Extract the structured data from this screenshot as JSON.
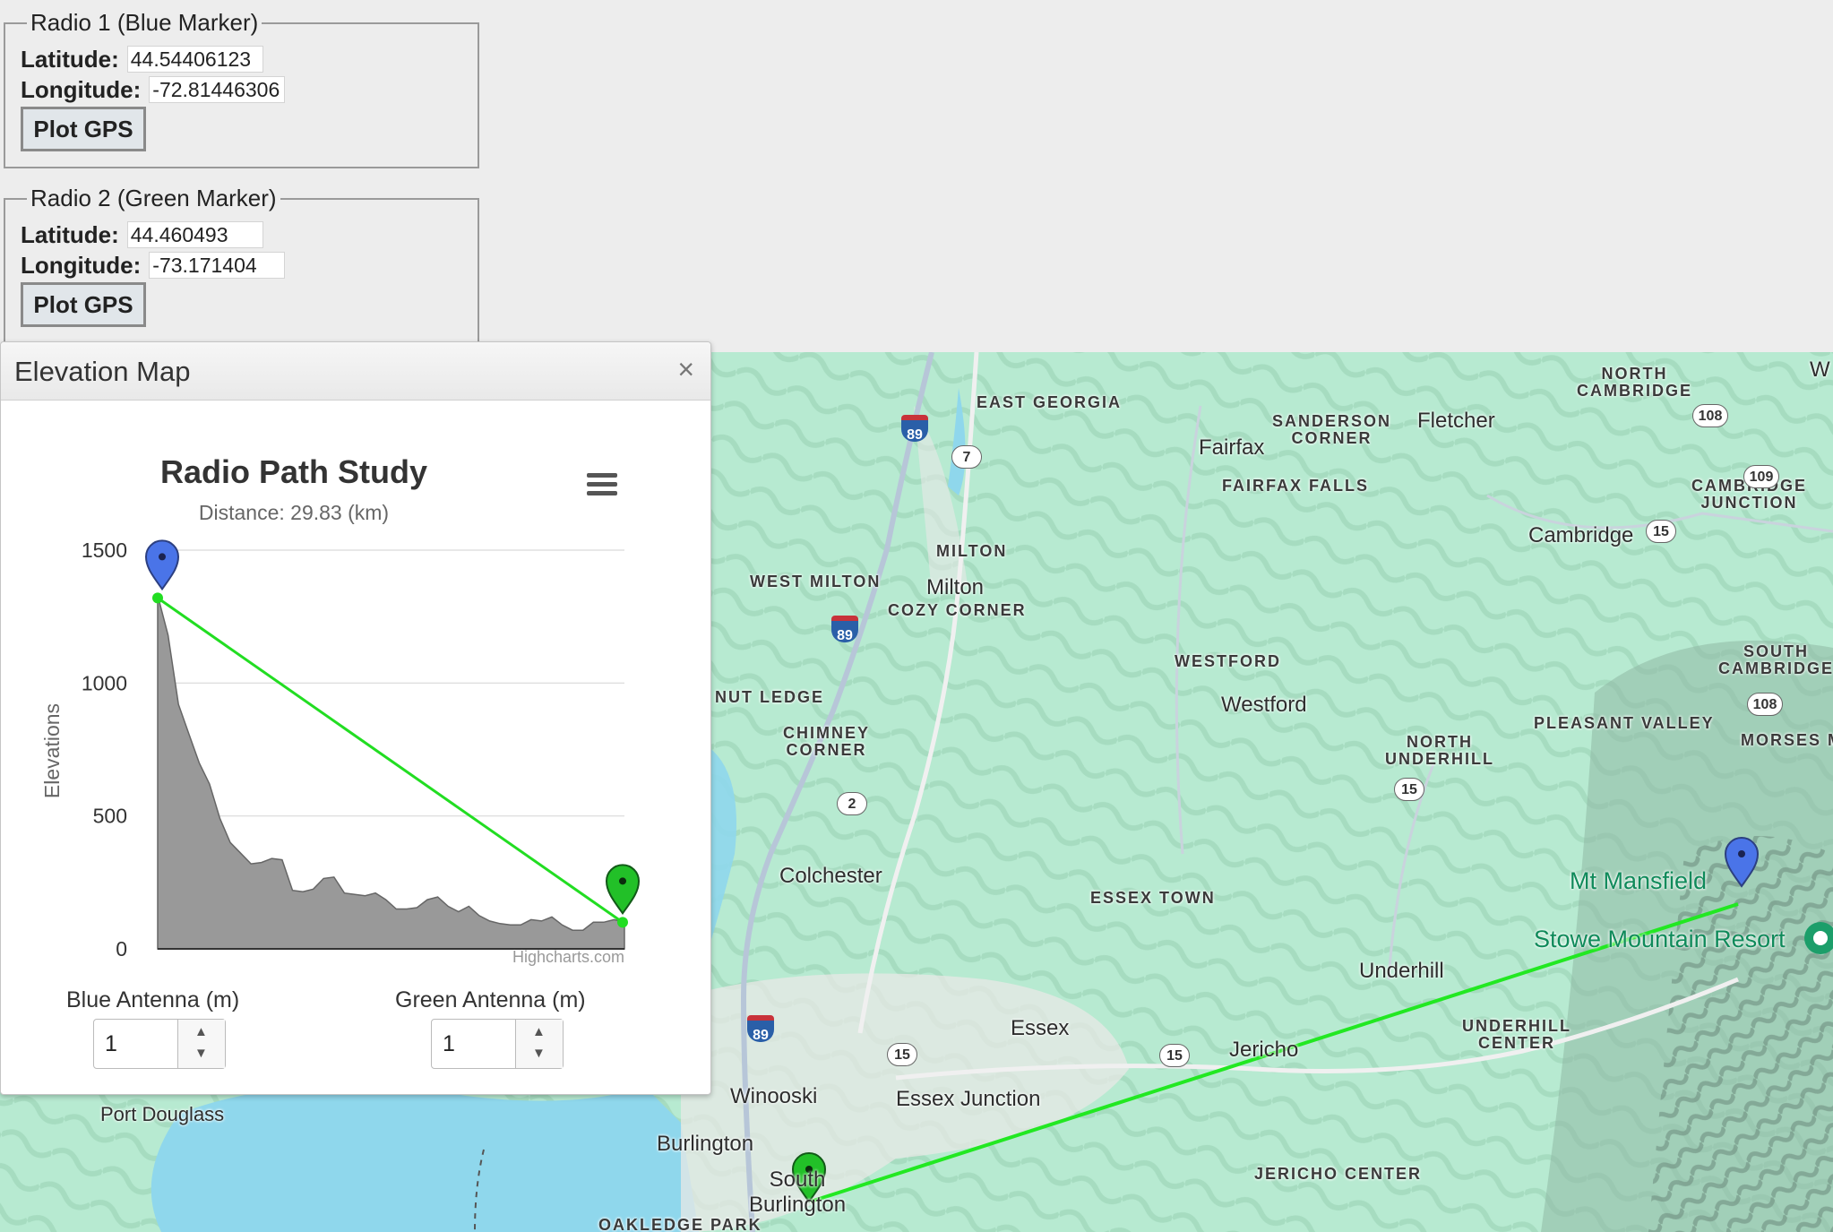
{
  "radio1": {
    "legend": "Radio 1 (Blue Marker)",
    "lat_label": "Latitude:",
    "lat_value": "44.54406123",
    "lon_label": "Longitude:",
    "lon_value": "-72.81446306",
    "button": "Plot GPS"
  },
  "radio2": {
    "legend": "Radio 2 (Green Marker)",
    "lat_label": "Latitude:",
    "lat_value": "44.460493",
    "lon_label": "Longitude:",
    "lon_value": "-73.171404",
    "button": "Plot GPS"
  },
  "dialog": {
    "title": "Elevation Map",
    "close": "×",
    "blue_antenna_label": "Blue Antenna (m)",
    "blue_antenna_value": "1",
    "green_antenna_label": "Green Antenna (m)",
    "green_antenna_value": "1",
    "up_arrow": "▲",
    "down_arrow": "▼"
  },
  "chart_data": {
    "type": "area",
    "title": "Radio Path Study",
    "subtitle": "Distance: 29.83 (km)",
    "ylabel": "Elevations",
    "xlabel": "",
    "ylim": [
      0,
      1500
    ],
    "yticks": [
      0,
      500,
      1000,
      1500
    ],
    "grid": true,
    "credit": "Highcharts.com",
    "series": [
      {
        "name": "",
        "color": "#999999",
        "values": [
          1330,
          1180,
          920,
          810,
          700,
          620,
          490,
          400,
          360,
          320,
          325,
          340,
          335,
          220,
          215,
          225,
          265,
          270,
          210,
          205,
          200,
          210,
          185,
          150,
          150,
          155,
          185,
          195,
          160,
          140,
          160,
          125,
          105,
          95,
          90,
          90,
          110,
          105,
          120,
          90,
          70,
          70,
          100,
          100,
          110,
          100
        ]
      }
    ],
    "path_line": {
      "color": "#22dd22",
      "start": 1320,
      "end": 100
    },
    "markers": [
      {
        "name": "blue-marker",
        "color": "#4a74e8",
        "position": "start"
      },
      {
        "name": "green-marker",
        "color": "#22c028",
        "position": "end"
      }
    ]
  },
  "map": {
    "labels": {
      "east_georgia": "EAST GEORGIA",
      "north_cambridge": "NORTH\nCAMBRIDGE",
      "w": "W",
      "sanderson_corner": "SANDERSON\nCORNER",
      "fletcher": "Fletcher",
      "fairfax": "Fairfax",
      "fairfax_falls": "FAIRFAX FALLS",
      "cambridge": "Cambridge",
      "cambridge_junction": "CAMBRIDGE\nJUNCTION",
      "milton_caps": "MILTON",
      "west_milton": "WEST MILTON",
      "milton": "Milton",
      "cozy_corner": "COZY CORNER",
      "westford_caps": "WESTFORD",
      "westford": "Westford",
      "south_cambridge": "SOUTH\nCAMBRIDGE",
      "nut_ledge": "NUT LEDGE",
      "chimney_corner": "CHIMNEY\nCORNER",
      "north_underhill": "NORTH\nUNDERHILL",
      "pleasant_valley": "PLEASANT VALLEY",
      "morses_m": "MORSES M",
      "colchester": "Colchester",
      "mt_mansfield": "Mt Mansfield",
      "stowe": "Stowe Mountain Resort",
      "essex_town": "ESSEX TOWN",
      "underhill": "Underhill",
      "essex": "Essex",
      "jericho": "Jericho",
      "underhill_center": "UNDERHILL\nCENTER",
      "winooski": "Winooski",
      "essex_junction": "Essex Junction",
      "port_douglass": "Port Douglass",
      "burlington": "Burlington",
      "south_burlington": "South\nBurlington",
      "jericho_center": "JERICHO CENTER",
      "oakledge_park": "OAKLEDGE PARK"
    },
    "shields": {
      "i89": "89",
      "us7": "7",
      "us2": "2",
      "vt15": "15",
      "vt108": "108",
      "vt109": "109"
    }
  }
}
